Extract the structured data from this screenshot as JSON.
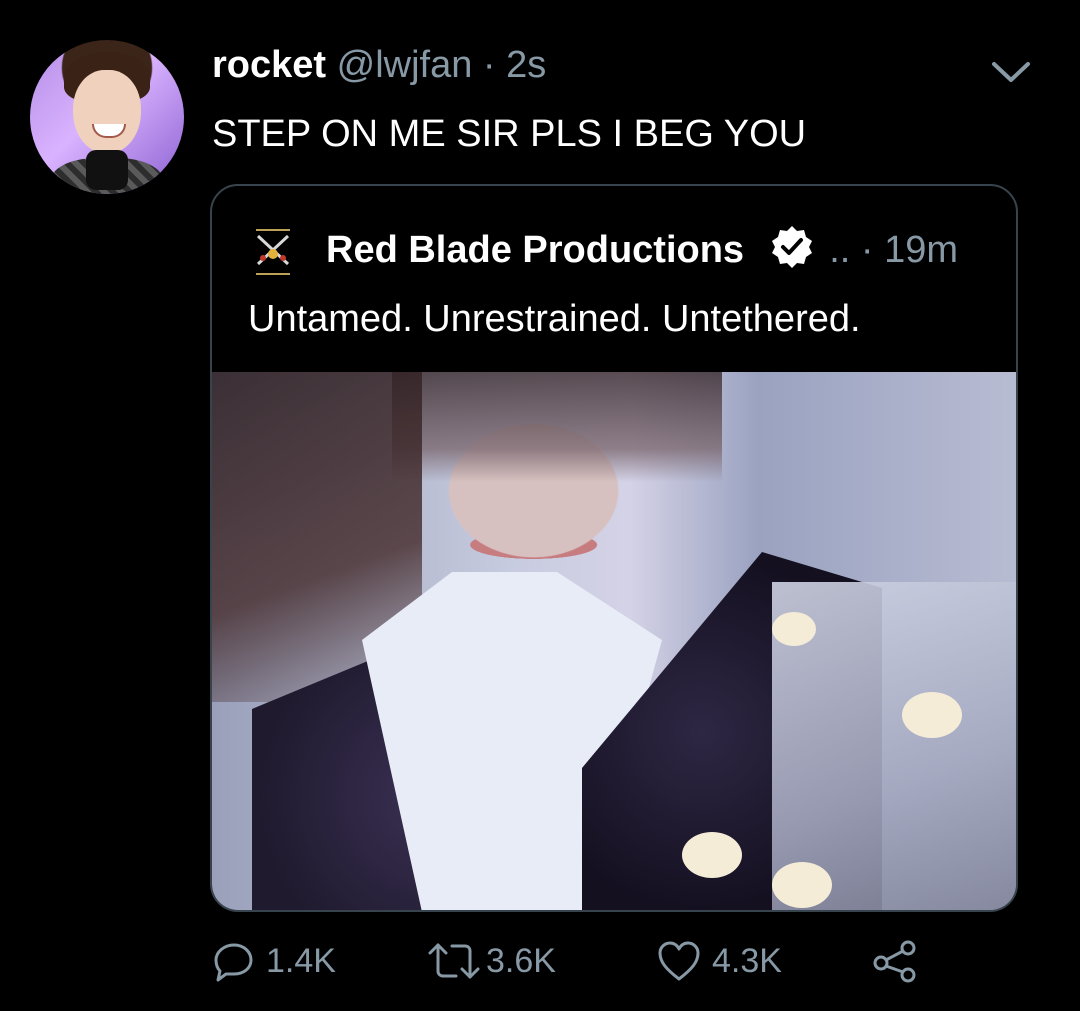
{
  "tweet": {
    "author_name": "rocket",
    "author_handle": "@lwjfan",
    "separator": "·",
    "time": "2s",
    "text": "STEP ON ME SIR PLS I BEG YOU"
  },
  "quoted_tweet": {
    "author_name": "Red Blade Productions",
    "meta": "..  · 19m",
    "text": "Untamed. Unrestrained. Untethered.",
    "verified": true
  },
  "actions": {
    "reply_count": "1.4K",
    "retweet_count": "3.6K",
    "like_count": "4.3K"
  },
  "icons": {
    "menu": "chevron-down-icon",
    "reply": "reply-icon",
    "retweet": "retweet-icon",
    "like": "heart-icon",
    "share": "share-icon",
    "verified": "verified-badge-icon"
  },
  "colors": {
    "background": "#000000",
    "primary_text": "#ffffff",
    "secondary_text": "#8899a6",
    "border": "#38444d"
  }
}
